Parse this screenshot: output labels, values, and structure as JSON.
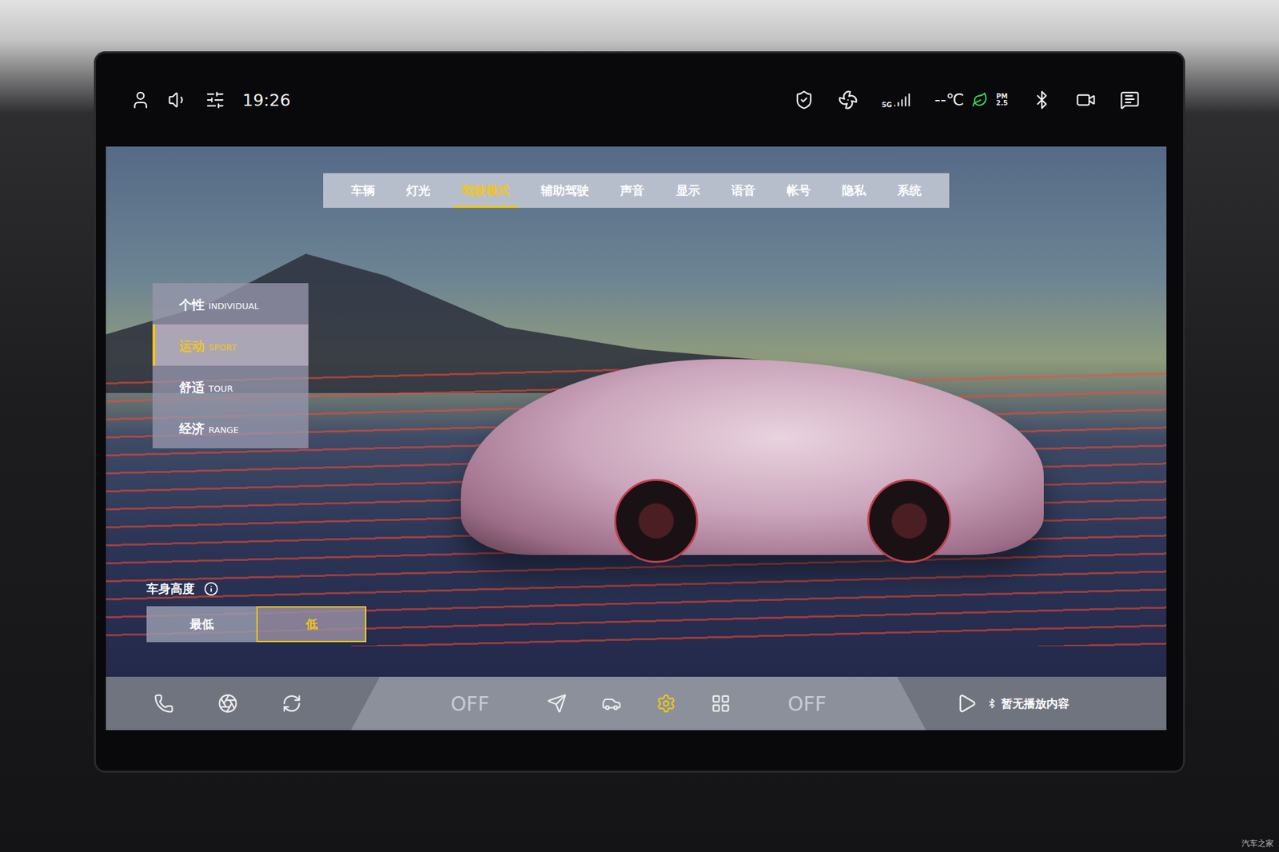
{
  "status_bar": {
    "time": "19:26",
    "network": "5G",
    "temperature": "--℃",
    "air_quality": {
      "top": "PM",
      "bottom": "2.5"
    }
  },
  "tabs": [
    {
      "label": "车辆",
      "selected": false
    },
    {
      "label": "灯光",
      "selected": false
    },
    {
      "label": "驾驶模式",
      "selected": true
    },
    {
      "label": "辅助驾驶",
      "selected": false
    },
    {
      "label": "声音",
      "selected": false
    },
    {
      "label": "显示",
      "selected": false
    },
    {
      "label": "语音",
      "selected": false
    },
    {
      "label": "帐号",
      "selected": false
    },
    {
      "label": "隐私",
      "selected": false
    },
    {
      "label": "系统",
      "selected": false
    }
  ],
  "drive_modes": [
    {
      "name": "个性",
      "label": "INDIVIDUAL",
      "selected": false
    },
    {
      "name": "运动",
      "label": "SPORT",
      "selected": true
    },
    {
      "name": "舒适",
      "label": "TOUR",
      "selected": false
    },
    {
      "name": "经济",
      "label": "RANGE",
      "selected": false
    }
  ],
  "ride_height": {
    "title": "车身高度",
    "options": [
      {
        "label": "最低",
        "selected": false
      },
      {
        "label": "低",
        "selected": true
      }
    ]
  },
  "dock": {
    "left_climate": "OFF",
    "right_climate": "OFF",
    "media": "暂无播放内容"
  },
  "watermark": "汽车之家"
}
